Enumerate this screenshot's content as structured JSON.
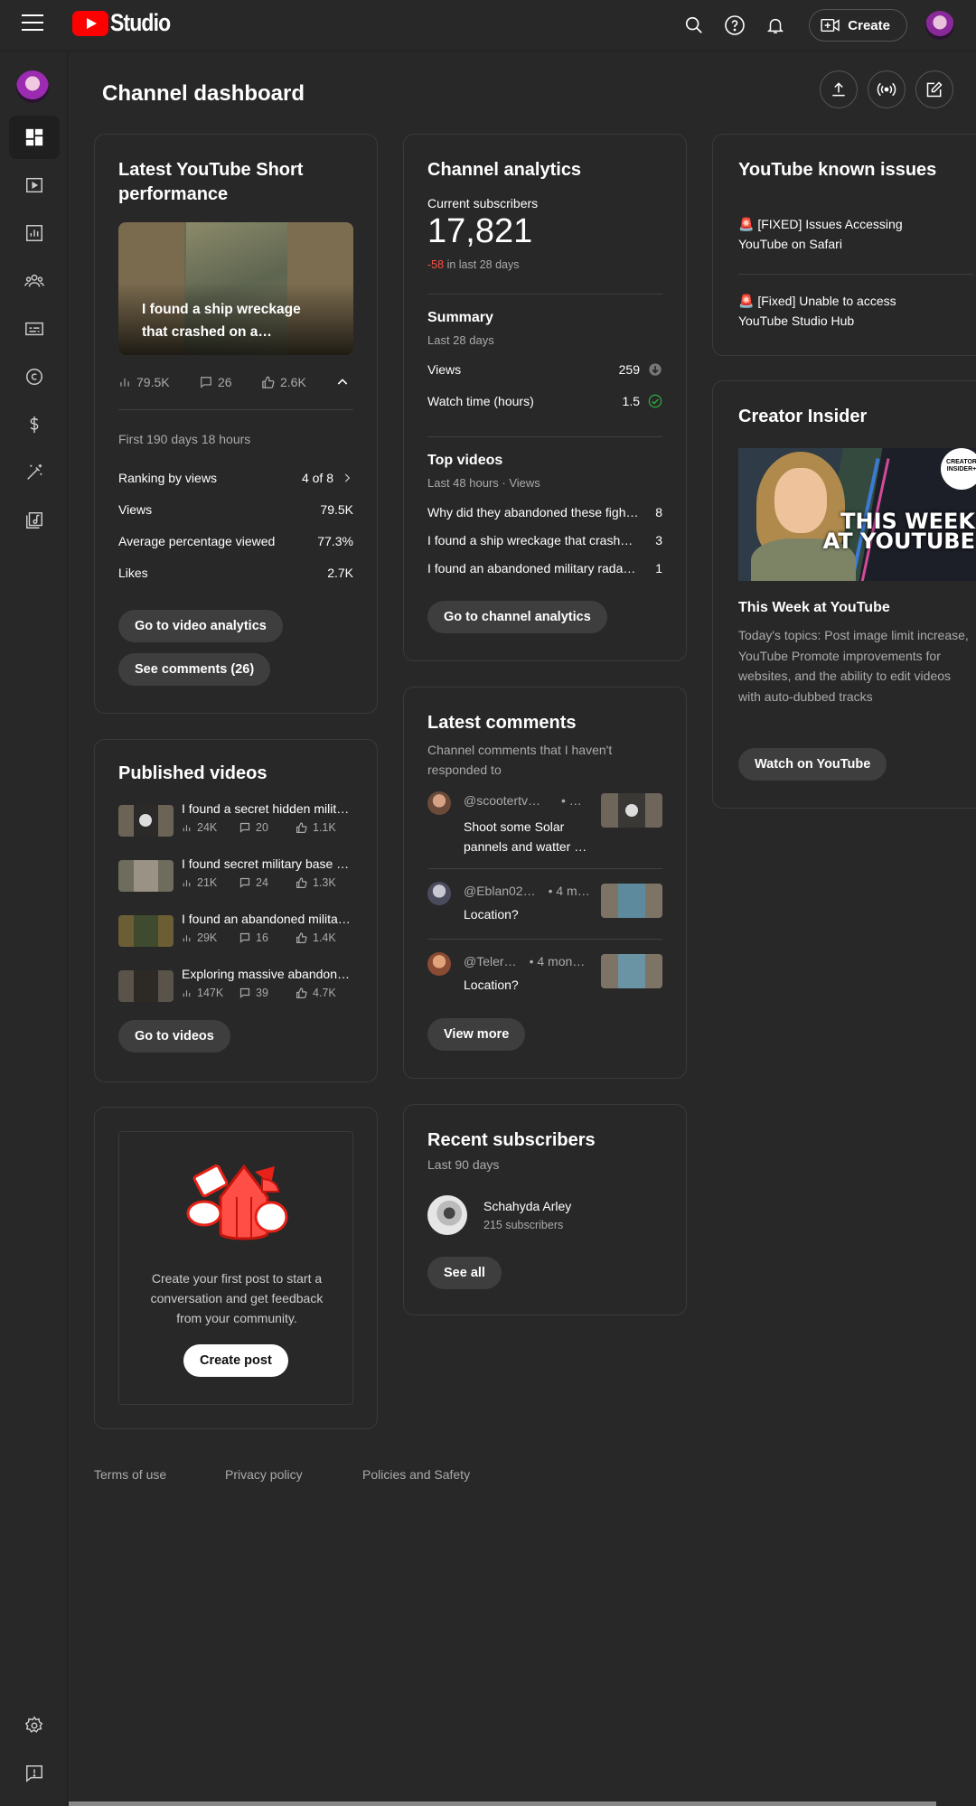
{
  "header": {
    "app_name": "Studio",
    "create_label": "Create"
  },
  "page": {
    "title": "Channel dashboard"
  },
  "short_card": {
    "title": "Latest YouTube Short performance",
    "thumb_caption": "I found a ship wreckage that crashed on a…",
    "views": "79.5K",
    "comments": "26",
    "likes": "2.6K",
    "period": "First 190 days 18 hours",
    "ranking_label": "Ranking by views",
    "ranking_value": "4 of 8",
    "rows": [
      {
        "label": "Views",
        "value": "79.5K"
      },
      {
        "label": "Average percentage viewed",
        "value": "77.3%"
      },
      {
        "label": "Likes",
        "value": "2.7K"
      }
    ],
    "btn_analytics": "Go to video analytics",
    "btn_comments": "See comments (26)"
  },
  "analytics_card": {
    "title": "Channel analytics",
    "subs_label": "Current subscribers",
    "subs_value": "17,821",
    "subs_change": "-58",
    "subs_change_suffix": "in last 28 days",
    "summary_title": "Summary",
    "summary_period": "Last 28 days",
    "summary_rows": [
      {
        "label": "Views",
        "value": "259"
      },
      {
        "label": "Watch time (hours)",
        "value": "1.5"
      }
    ],
    "top_title": "Top videos",
    "top_period": "Last 48 hours · Views",
    "top_videos": [
      {
        "title": "Why did they abandoned these fight…",
        "value": "8"
      },
      {
        "title": "I found a ship wreckage that crashe…",
        "value": "3"
      },
      {
        "title": "I found an abandoned military radar …",
        "value": "1"
      }
    ],
    "btn": "Go to channel analytics"
  },
  "issues_card": {
    "title": "YouTube known issues",
    "items": [
      "🚨 [FIXED] Issues Accessing YouTube on Safari",
      "🚨 [Fixed] Unable to access YouTube Studio Hub"
    ]
  },
  "insider_card": {
    "title": "Creator Insider",
    "banner_text": "THIS WEEK AT YOUTUBE",
    "badge": "CREATOR INSIDER+",
    "video_title": "This Week at YouTube",
    "desc": "Today's topics: Post image limit increase, YouTube Promote improvements for websites, and the ability to edit videos with auto-dubbed tracks",
    "btn": "Watch on YouTube"
  },
  "published_card": {
    "title": "Published videos",
    "videos": [
      {
        "title": "I found a secret hidden milit…",
        "views": "24K",
        "comments": "20",
        "likes": "1.1K"
      },
      {
        "title": "I found secret military base …",
        "views": "21K",
        "comments": "24",
        "likes": "1.3K"
      },
      {
        "title": "I found an abandoned milita…",
        "views": "29K",
        "comments": "16",
        "likes": "1.4K"
      },
      {
        "title": "Exploring massive abandon…",
        "views": "147K",
        "comments": "39",
        "likes": "4.7K"
      }
    ],
    "btn": "Go to videos"
  },
  "comments_card": {
    "title": "Latest comments",
    "subtitle": "Channel comments that I haven't responded to",
    "comments": [
      {
        "author": "@scootertv9…",
        "time": "• 3…",
        "text": "Shoot some Solar pannels and watter …"
      },
      {
        "author": "@Eblan02…",
        "time": "• 4 m…",
        "text": "Location?"
      },
      {
        "author": "@Teler…",
        "time": "• 4 mon…",
        "text": "Location?"
      }
    ],
    "btn": "View more"
  },
  "post_card": {
    "text": "Create your first post to start a conversation and get feedback from your community.",
    "btn": "Create post"
  },
  "subscribers_card": {
    "title": "Recent subscribers",
    "period": "Last 90 days",
    "name": "Schahyda Arley",
    "count": "215 subscribers",
    "btn": "See all"
  },
  "footer": {
    "terms": "Terms of use",
    "privacy": "Privacy policy",
    "policies": "Policies and Safety"
  },
  "colors": {
    "negative": "#ff4e45",
    "positive": "#2ba640",
    "brand": "#ff0000"
  }
}
